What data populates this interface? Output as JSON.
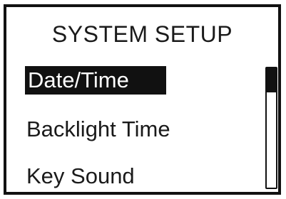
{
  "screen": {
    "title": "SYSTEM SETUP"
  },
  "menu": {
    "items": [
      {
        "label": "Date/Time",
        "selected": true
      },
      {
        "label": "Backlight Time",
        "selected": false
      },
      {
        "label": "Key Sound",
        "selected": false
      }
    ]
  },
  "scrollbar": {
    "thumb_fraction": 0.2
  },
  "colors": {
    "foreground": "#111111",
    "background": "#ffffff"
  }
}
